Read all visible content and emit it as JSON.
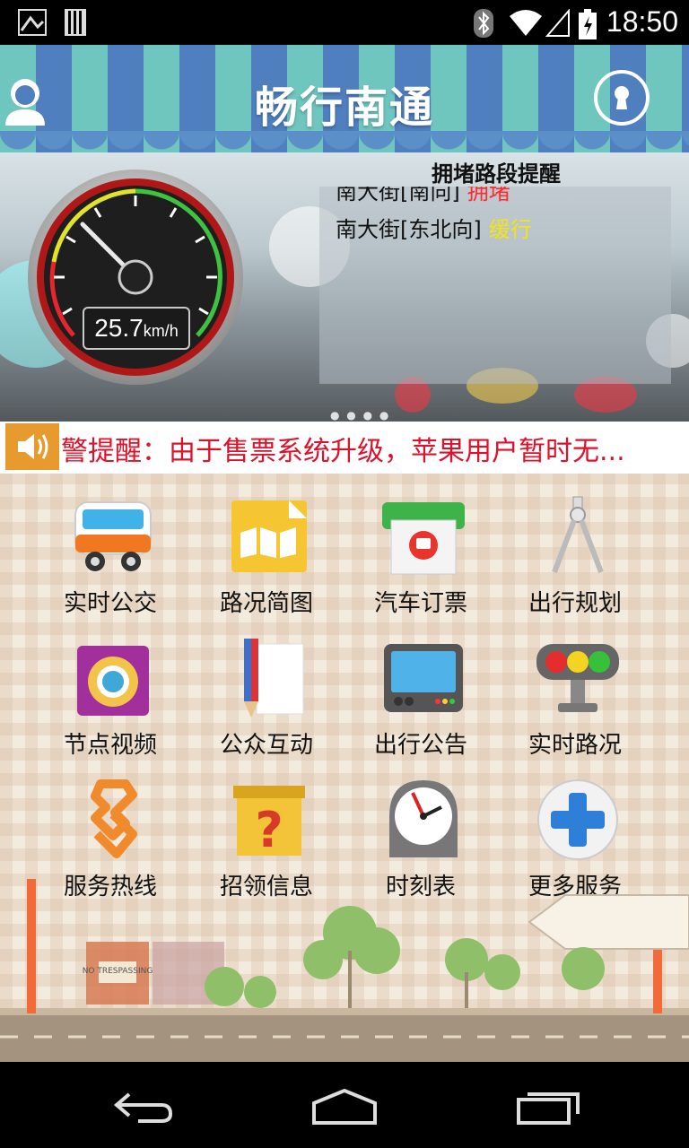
{
  "status_bar": {
    "time": "18:50"
  },
  "header": {
    "title": "畅行南通"
  },
  "speedometer": {
    "value": "25.7",
    "unit": "km/h"
  },
  "congestion": {
    "title": "拥堵路段提醒",
    "items": [
      {
        "road": "南大街[南向]",
        "status": "拥堵",
        "color": "#ff2a2a"
      },
      {
        "road": "南大街[东北向]",
        "status": "缓行",
        "color": "#f3e414"
      }
    ]
  },
  "notice": {
    "text": "警提醒：由于售票系统升级，苹果用户暂时无..."
  },
  "menu": [
    {
      "label": "实时公交",
      "icon": "bus-icon"
    },
    {
      "label": "路况简图",
      "icon": "map-icon"
    },
    {
      "label": "汽车订票",
      "icon": "ticket-icon"
    },
    {
      "label": "出行规划",
      "icon": "compass-icon"
    },
    {
      "label": "节点视频",
      "icon": "camera-icon"
    },
    {
      "label": "公众互动",
      "icon": "pencil-icon"
    },
    {
      "label": "出行公告",
      "icon": "monitor-icon"
    },
    {
      "label": "实时路况",
      "icon": "traffic-light-icon"
    },
    {
      "label": "服务热线",
      "icon": "hotline-icon"
    },
    {
      "label": "招领信息",
      "icon": "question-box-icon"
    },
    {
      "label": "时刻表",
      "icon": "clock-icon"
    },
    {
      "label": "更多服务",
      "icon": "plus-icon"
    }
  ],
  "scenery": {
    "sign_text": "NO TRESPASSING"
  }
}
